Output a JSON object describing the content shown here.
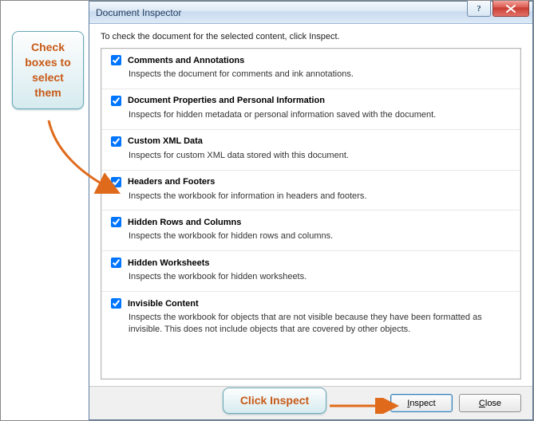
{
  "dialog": {
    "title": "Document Inspector",
    "instruction": "To check the document for the selected content, click Inspect.",
    "options": [
      {
        "label": "Comments and Annotations",
        "desc": "Inspects the document for comments and ink annotations.",
        "checked": true
      },
      {
        "label": "Document Properties and Personal Information",
        "desc": "Inspects for hidden metadata or personal information saved with the document.",
        "checked": true
      },
      {
        "label": "Custom XML Data",
        "desc": "Inspects for custom XML data stored with this document.",
        "checked": true
      },
      {
        "label": "Headers and Footers",
        "desc": "Inspects the workbook for information in headers and footers.",
        "checked": true
      },
      {
        "label": "Hidden Rows and Columns",
        "desc": "Inspects the workbook for hidden rows and columns.",
        "checked": true
      },
      {
        "label": "Hidden Worksheets",
        "desc": "Inspects the workbook for hidden worksheets.",
        "checked": true
      },
      {
        "label": "Invisible Content",
        "desc": "Inspects the workbook for objects that are not visible because they have been formatted as invisible. This does not include objects that are covered by other objects.",
        "checked": true
      }
    ],
    "buttons": {
      "inspect": "Inspect",
      "close": "Close"
    },
    "help_symbol": "?"
  },
  "annotations": {
    "callout_top": "Check boxes to select them",
    "callout_bottom": "Click Inspect"
  }
}
